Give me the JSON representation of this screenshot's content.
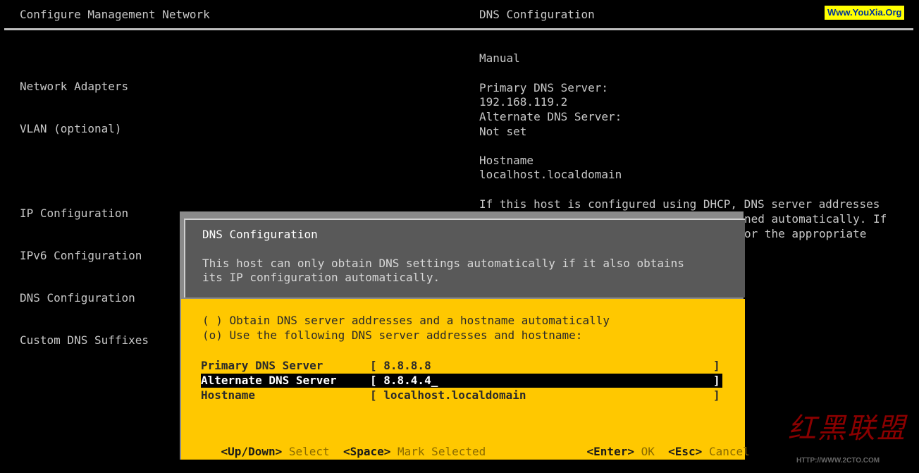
{
  "header": {
    "left_title": "Configure Management Network",
    "right_title": "DNS Configuration",
    "watermark": "Www.YouXia.Org"
  },
  "menu": {
    "items": [
      "Network Adapters",
      "VLAN (optional)",
      "",
      "IP Configuration",
      "IPv6 Configuration",
      "DNS Configuration",
      "Custom DNS Suffixes"
    ]
  },
  "detail": {
    "mode": "Manual",
    "primary_label": "Primary DNS Server:",
    "primary_value": "192.168.119.2",
    "alternate_label": "Alternate DNS Server:",
    "alternate_value": "Not set",
    "hostname_label": "Hostname",
    "hostname_value": "localhost.localdomain",
    "help_line1": "If this host is configured using DHCP, DNS server addresses",
    "help_line2": "ned automatically. If",
    "help_line3": "or the appropriate"
  },
  "dialog": {
    "title": "DNS Configuration",
    "desc_line1": "This host can only obtain DNS settings automatically if it also obtains",
    "desc_line2": "its IP configuration automatically.",
    "option_auto": "( ) Obtain DNS server addresses and a hostname automatically",
    "option_manual": "(o) Use the following DNS server addresses and hostname:",
    "fields": [
      {
        "label": "Primary DNS Server",
        "value": "[ 8.8.8.8",
        "end": "]"
      },
      {
        "label": "Alternate DNS Server",
        "value": "[ 8.8.4.4_",
        "end": "]"
      },
      {
        "label": "Hostname",
        "value": "[ localhost.localdomain",
        "end": "]"
      }
    ],
    "footer": {
      "updown_key": "<Up/Down>",
      "updown_desc": "Select",
      "space_key": "<Space>",
      "space_desc": "Mark Selected",
      "enter_key": "<Enter>",
      "enter_desc": "OK",
      "esc_key": "<Esc>",
      "esc_desc": "Cancel"
    }
  },
  "seal": {
    "text": "红黑联盟",
    "url": "HTTP://WWW.2CTO.COM"
  }
}
